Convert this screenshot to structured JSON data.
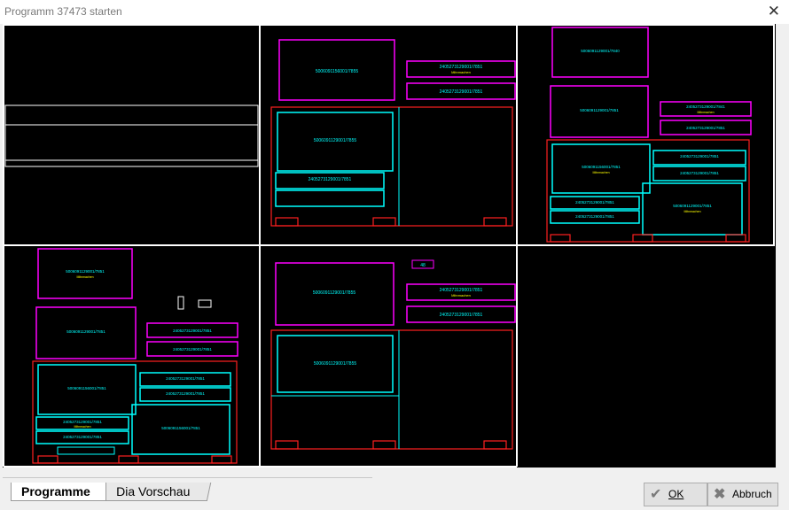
{
  "window": {
    "title": "Programm 37473 starten",
    "close_glyph": "✕"
  },
  "tabs": [
    {
      "label": "Programme"
    },
    {
      "label": "Dia Vorschau"
    }
  ],
  "buttons": {
    "ok": "OK",
    "cancel": "Abbruch",
    "ok_icon": "check-icon",
    "cancel_icon": "x-icon"
  },
  "colors": {
    "background": "#000000",
    "magenta": "#ff00ff",
    "cyan": "#00ffff",
    "red": "#ff2020",
    "yellow": "#ffff00",
    "white": "#ffffff"
  },
  "slides": [
    {
      "labels": []
    },
    {
      "labels": [
        "5006091156001/7855",
        "2405273129001/7851",
        "Mitnmachen",
        "2405273129001/7851",
        "5006091129001/7855",
        "2405273129001/7851"
      ]
    },
    {
      "labels": [
        "5006091129001/7840",
        "5006091129001/7851",
        "2405273129001/7841",
        "Mitnmachen",
        "2405273129001/7851",
        "5006091156001/7851",
        "Mitnmachen",
        "2405273129001/7851",
        "2405273129001/7851",
        "5006091129001/7851",
        "Mitnmachen",
        "2405273129001/7851",
        "2405273129001/7851"
      ]
    },
    {
      "labels": [
        "5006091129001/7851",
        "Mitnmachen",
        "5006091129001/7851",
        "2405273129001/7851",
        "2405273129001/7851",
        "5006091156001/7851",
        "2405273129001/7851",
        "2405273129001/7851",
        "5006091156001/7851",
        "2405273129001/7851",
        "Mitnmachen",
        "2405273129001/7851"
      ]
    },
    {
      "labels": [
        "48",
        "5006091129001/7855",
        "2405273129001/7851",
        "Mitnmachen",
        "2405273129001/7851",
        "5006091129001/7855"
      ]
    }
  ]
}
